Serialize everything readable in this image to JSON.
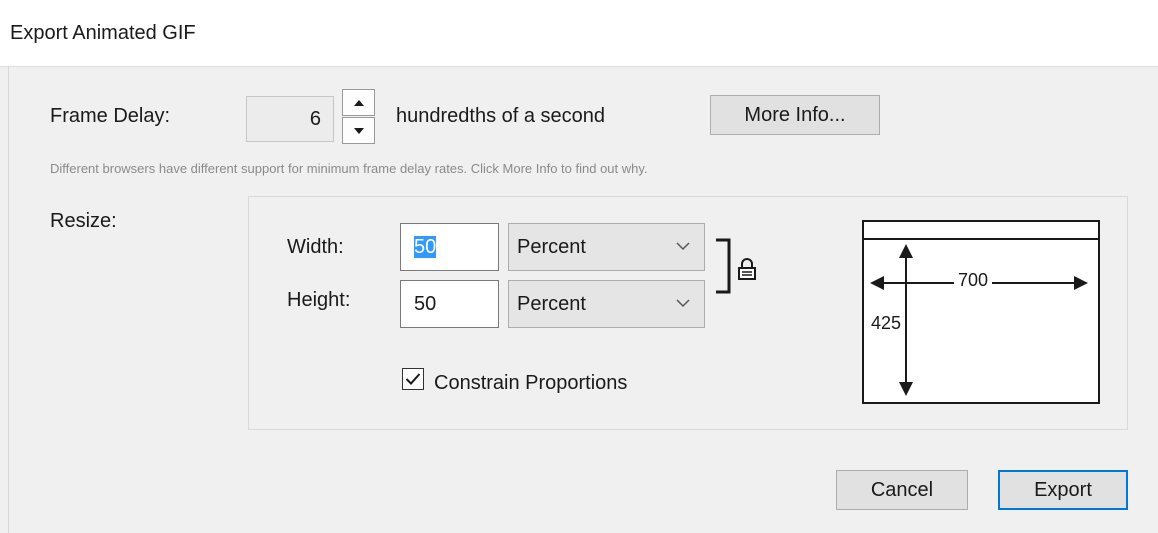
{
  "window": {
    "title": "Export Animated GIF"
  },
  "frame_delay": {
    "label": "Frame Delay:",
    "value": "6",
    "unit_label": "hundredths of a second",
    "more_info_label": "More Info...",
    "note": "Different browsers have different support for minimum frame delay rates. Click More Info to find out why."
  },
  "resize": {
    "label": "Resize:",
    "width": {
      "label": "Width:",
      "value": "50",
      "unit": "Percent"
    },
    "height": {
      "label": "Height:",
      "value": "50",
      "unit": "Percent"
    },
    "constrain_label": "Constrain Proportions",
    "constrain_checked": true,
    "preview": {
      "width_value": "700",
      "height_value": "425"
    }
  },
  "buttons": {
    "cancel_label": "Cancel",
    "export_label": "Export"
  },
  "colors": {
    "accent": "#0078d7",
    "selection": "#3399ff"
  },
  "icons": {
    "spin_up": "chevron-up-icon",
    "spin_down": "chevron-down-icon",
    "dropdown": "chevron-down-icon",
    "lock": "lock-icon",
    "check": "checkmark-icon"
  }
}
